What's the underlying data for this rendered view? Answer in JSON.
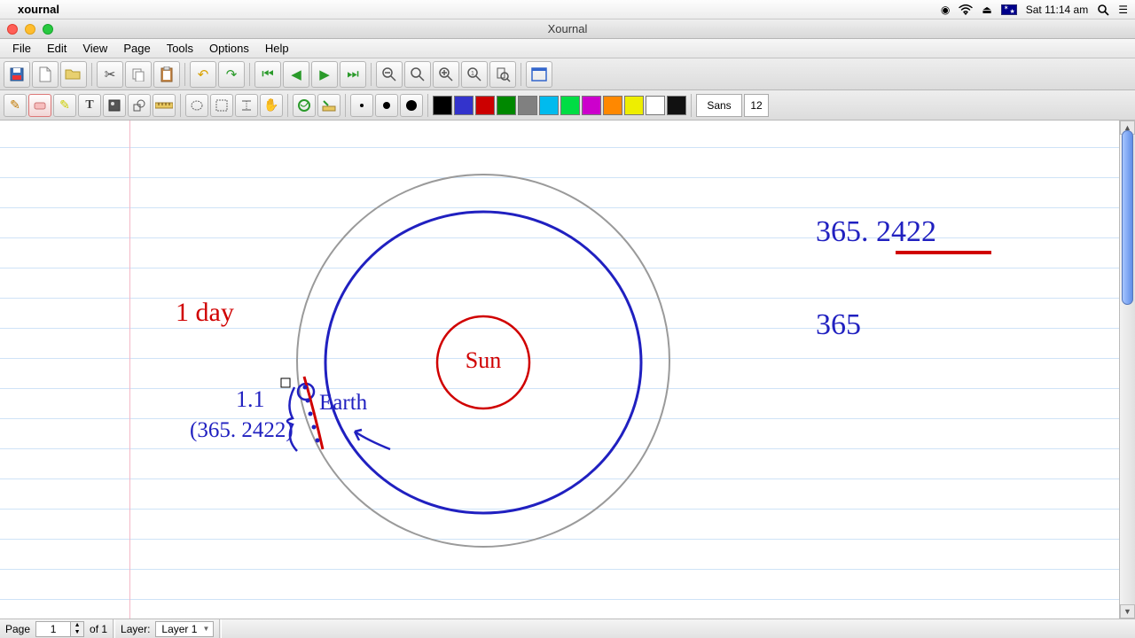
{
  "mac": {
    "app_name": "xournal",
    "clock": "Sat 11:14 am"
  },
  "window": {
    "title": "Xournal"
  },
  "menus": {
    "file": "File",
    "edit": "Edit",
    "view": "View",
    "page": "Page",
    "tools": "Tools",
    "options": "Options",
    "help": "Help"
  },
  "toolbar2": {
    "font": "Sans",
    "font_size": "12",
    "swatches": [
      "#000000",
      "#3333cc",
      "#cc0000",
      "#008800",
      "#808080",
      "#00bbee",
      "#00dd44",
      "#cc00cc",
      "#ff8800",
      "#eeee00",
      "#ffffff",
      "#111111"
    ]
  },
  "statusbar": {
    "page_label": "Page",
    "page_current": "1",
    "page_total": "of 1",
    "layer_label": "Layer:",
    "layer_value": "Layer 1"
  },
  "canvas_text": {
    "one_day": "1  day",
    "one_point_one": "1.1",
    "paren": "(365. 2422)",
    "sun": "Sun",
    "earth": "Earth",
    "val_a": "365. 2422",
    "val_b": "365"
  }
}
